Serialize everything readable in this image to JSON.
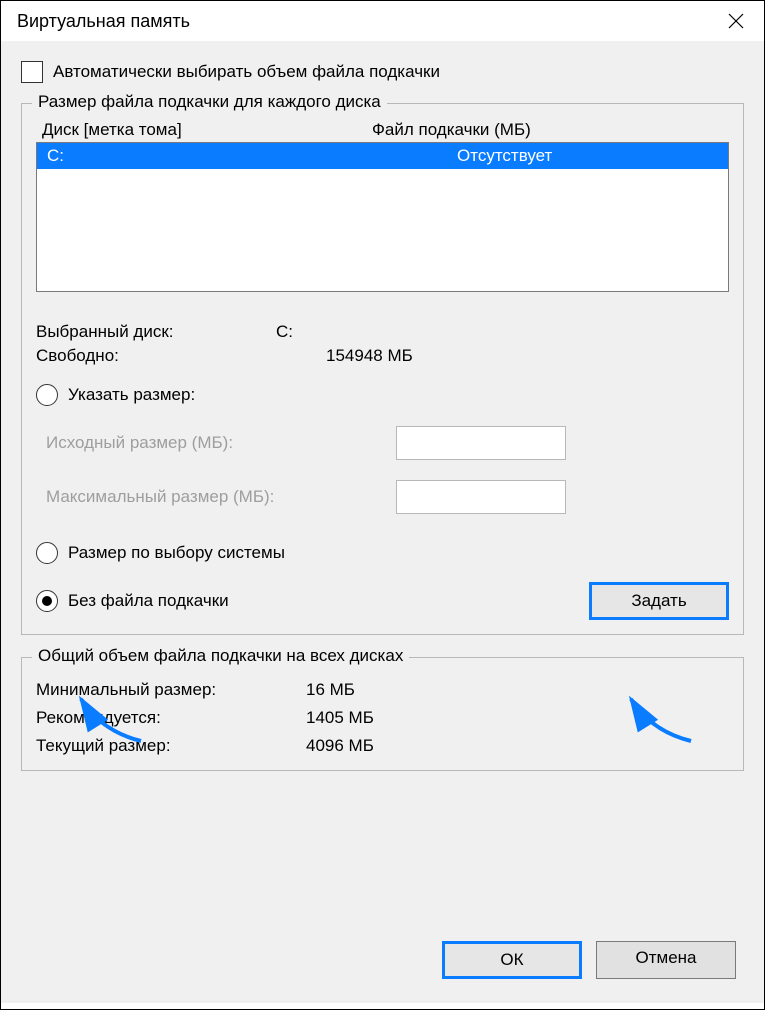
{
  "title": "Виртуальная память",
  "auto_manage_label": "Автоматически выбирать объем файла подкачки",
  "group1_legend": "Размер файла подкачки для каждого диска",
  "list_headers": {
    "drive": "Диск [метка тома]",
    "pf": "Файл подкачки (МБ)"
  },
  "drives": [
    {
      "label": "C:",
      "pf": "Отсутствует"
    }
  ],
  "selected": {
    "drive_label": "Выбранный диск:",
    "drive_value": "C:",
    "free_label": "Свободно:",
    "free_value": "154948 МБ"
  },
  "radios": {
    "custom": "Указать размер:",
    "system": "Размер по выбору системы",
    "none": "Без файла подкачки"
  },
  "custom_inputs": {
    "initial_label": "Исходный размер (МБ):",
    "max_label": "Максимальный размер (МБ):"
  },
  "set_button": "Задать",
  "group2_legend": "Общий объем файла подкачки на всех дисках",
  "totals": {
    "min_label": "Минимальный размер:",
    "min_value": "16 МБ",
    "rec_label": "Рекомендуется:",
    "rec_value": "1405 МБ",
    "cur_label": "Текущий размер:",
    "cur_value": "4096 МБ"
  },
  "buttons": {
    "ok": "ОК",
    "cancel": "Отмена"
  }
}
